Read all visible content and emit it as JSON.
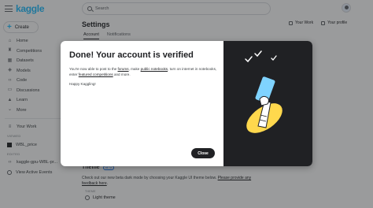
{
  "brand": {
    "logo_text": "kaggle"
  },
  "sidebar": {
    "create_label": "Create",
    "items": [
      {
        "label": "Home",
        "icon": "home-icon"
      },
      {
        "label": "Competitions",
        "icon": "trophy-icon"
      },
      {
        "label": "Datasets",
        "icon": "table-icon"
      },
      {
        "label": "Models",
        "icon": "models-icon"
      },
      {
        "label": "Code",
        "icon": "code-icon"
      },
      {
        "label": "Discussions",
        "icon": "comments-icon"
      },
      {
        "label": "Learn",
        "icon": "school-icon"
      },
      {
        "label": "More",
        "icon": "chevron-down-icon"
      }
    ],
    "your_work_label": "Your Work",
    "viewed_label": "VIEWED",
    "viewed_items": [
      {
        "label": "WBL_price"
      }
    ],
    "edited_label": "EDITED",
    "edited_items": [
      {
        "label": "kaggle-gpu-WBL-pr..."
      }
    ],
    "view_active_events_label": "View Active Events"
  },
  "header": {
    "search_placeholder": "Search",
    "your_work_label": "Your Work",
    "your_profile_label": "Your profile"
  },
  "settings": {
    "title": "Settings",
    "tabs": [
      {
        "label": "Account",
        "active": true
      },
      {
        "label": "Notifications",
        "active": false
      }
    ],
    "theme": {
      "title": "Theme",
      "badge": "BETA",
      "desc_prefix": "Check out our new beta dark mode by choosing your Kaggle UI theme below.",
      "desc_link": "Please provide any feedback here",
      "desc_suffix": ".",
      "field_label": "THEME",
      "selected": "Light theme"
    }
  },
  "modal": {
    "title": "Done! Your account is verified",
    "body_parts": [
      {
        "text": "You're now able to post to the ",
        "link": false
      },
      {
        "text": "forums",
        "link": true
      },
      {
        "text": ", make ",
        "link": false
      },
      {
        "text": "public notebooks",
        "link": true
      },
      {
        "text": ", turn on internet in notebooks, enter ",
        "link": false
      },
      {
        "text": "featured competitions",
        "link": true
      },
      {
        "text": " and more.",
        "link": false
      }
    ],
    "signoff": "Happy Kaggling!",
    "close_label": "Close"
  },
  "colors": {
    "brand": "#20beff",
    "dark_panel": "#202124",
    "yellow": "#ffd84d",
    "phone_blue": "#7fd3ff"
  }
}
